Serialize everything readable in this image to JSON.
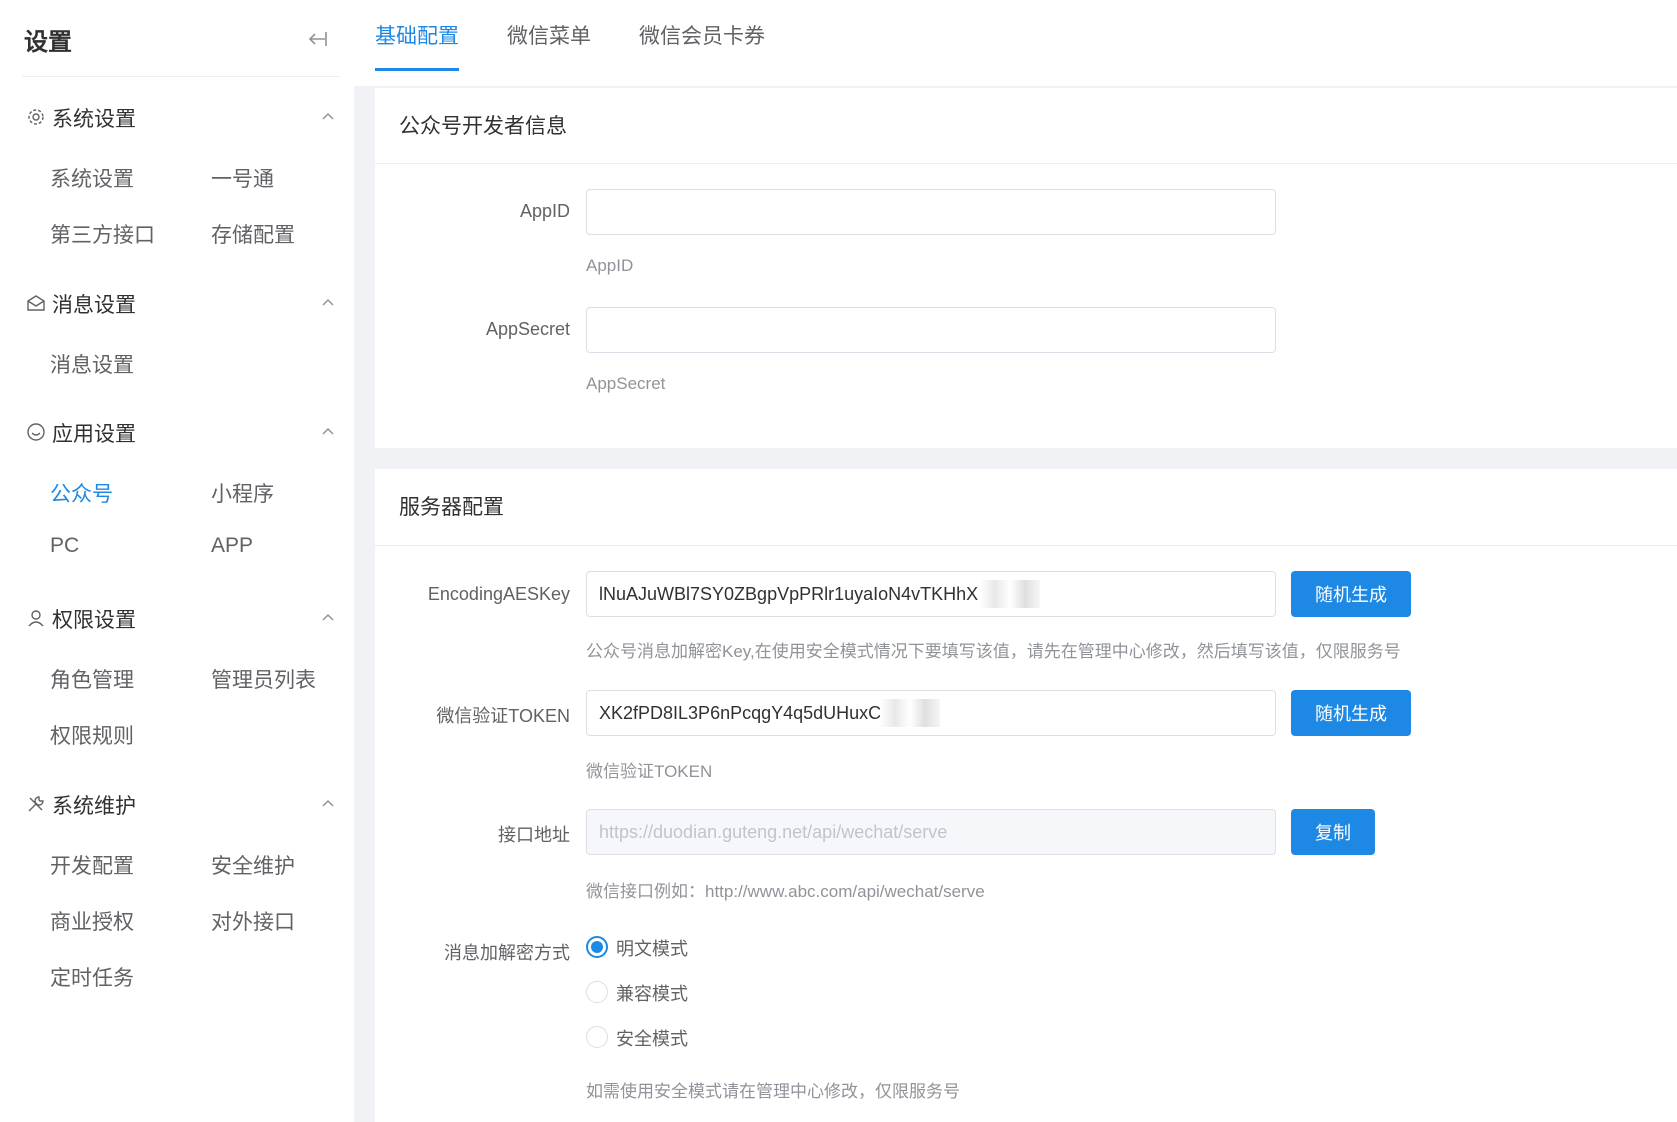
{
  "sidebar": {
    "title": "设置",
    "groups": [
      {
        "label": "系统设置",
        "icon": "gear-icon",
        "items": [
          "系统设置",
          "一号通",
          "第三方接口",
          "存储配置"
        ]
      },
      {
        "label": "消息设置",
        "icon": "envelope-icon",
        "items": [
          "消息设置"
        ]
      },
      {
        "label": "应用设置",
        "icon": "smile-icon",
        "items": [
          "公众号",
          "小程序",
          "PC",
          "APP"
        ]
      },
      {
        "label": "权限设置",
        "icon": "user-icon",
        "items": [
          "角色管理",
          "管理员列表",
          "权限规则"
        ]
      },
      {
        "label": "系统维护",
        "icon": "tools-icon",
        "items": [
          "开发配置",
          "安全维护",
          "商业授权",
          "对外接口",
          "定时任务"
        ]
      }
    ],
    "active_item": "公众号"
  },
  "tabs": [
    {
      "label": "基础配置",
      "active": true
    },
    {
      "label": "微信菜单",
      "active": false
    },
    {
      "label": "微信会员卡券",
      "active": false
    }
  ],
  "developer_card": {
    "title": "公众号开发者信息",
    "appid": {
      "label": "AppID",
      "value": "",
      "help": "AppID"
    },
    "appsecret": {
      "label": "AppSecret",
      "value": "",
      "help": "AppSecret"
    }
  },
  "server_card": {
    "title": "服务器配置",
    "aeskey": {
      "label": "EncodingAESKey",
      "value": "lNuAJuWBl7SY0ZBgpVpPRlr1uyaIoN4vTKHhX",
      "button": "随机生成",
      "help": "公众号消息加解密Key,在使用安全模式情况下要填写该值，请先在管理中心修改，然后填写该值，仅限服务号"
    },
    "token": {
      "label": "微信验证TOKEN",
      "value": "XK2fPD8IL3P6nPcqgY4q5dUHuxC",
      "button": "随机生成",
      "help": "微信验证TOKEN"
    },
    "api_url": {
      "label": "接口地址",
      "value": "https://duodian.guteng.net/api/wechat/serve",
      "button": "复制",
      "help": "微信接口例如：http://www.abc.com/api/wechat/serve"
    },
    "encrypt_mode": {
      "label": "消息加解密方式",
      "options": [
        "明文模式",
        "兼容模式",
        "安全模式"
      ],
      "selected": "明文模式",
      "help": "如需使用安全模式请在管理中心修改，仅限服务号"
    }
  },
  "colors": {
    "accent": "#1e88e5",
    "page_bg": "#f0f2f5"
  }
}
